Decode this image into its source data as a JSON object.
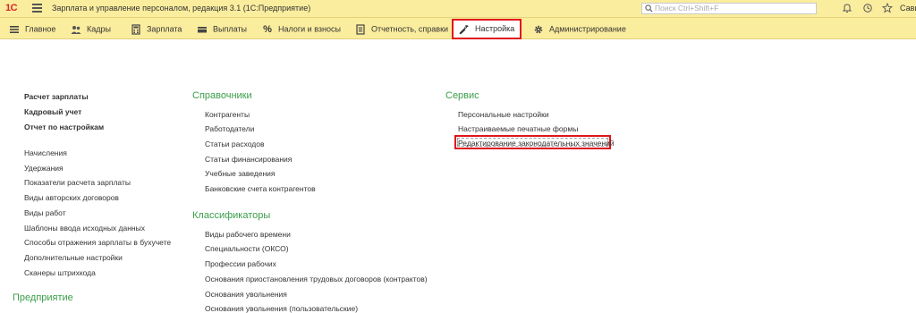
{
  "titlebar": {
    "logo": "1С",
    "title": "Зарплата и управление персоналом, редакция 3.1  (1С:Предприятие)",
    "search_placeholder": "Поиск Ctrl+Shift+F",
    "user": "Савин"
  },
  "sections": [
    {
      "label": "Главное",
      "icon": "menu-lines-icon"
    },
    {
      "label": "Кадры",
      "icon": "people-icon"
    },
    {
      "label": "Зарплата",
      "icon": "calculator-icon"
    },
    {
      "label": "Выплаты",
      "icon": "wallet-icon"
    },
    {
      "label": "Налоги и взносы",
      "icon": "percent-icon"
    },
    {
      "label": "Отчетность, справки",
      "icon": "report-icon"
    },
    {
      "label": "Настройка",
      "icon": "wrench-icon",
      "active": true
    },
    {
      "label": "Администрирование",
      "icon": "gear-icon"
    }
  ],
  "left": {
    "bold_links": [
      "Расчет зарплаты",
      "Кадровый учет",
      "Отчет по настройкам"
    ],
    "links": [
      "Начисления",
      "Удержания",
      "Показатели расчета зарплаты",
      "Виды авторских договоров",
      "Виды работ",
      "Шаблоны ввода исходных данных",
      "Способы отражения зарплаты в бухучете",
      "Дополнительные настройки",
      "Сканеры штрихкода"
    ],
    "bottom_heading": "Предприятие"
  },
  "middle": {
    "heading1": "Справочники",
    "links1": [
      "Контрагенты",
      "Работодатели",
      "Статьи расходов",
      "Статьи финансирования",
      "Учебные заведения",
      "Банковские счета контрагентов"
    ],
    "heading2": "Классификаторы",
    "links2": [
      "Виды рабочего времени",
      "Специальности (ОКСО)",
      "Профессии рабочих",
      "Основания приостановления трудовых договоров (контрактов)",
      "Основания увольнения",
      "Основания увольнения (пользовательские)"
    ]
  },
  "right": {
    "heading": "Сервис",
    "links": [
      "Персональные настройки",
      "Настраиваемые печатные формы",
      "Редактирование законодательных значений"
    ]
  },
  "colors": {
    "accent": "#3a9e4a",
    "bar": "#fbed9e",
    "highlight": "#e1141c"
  }
}
